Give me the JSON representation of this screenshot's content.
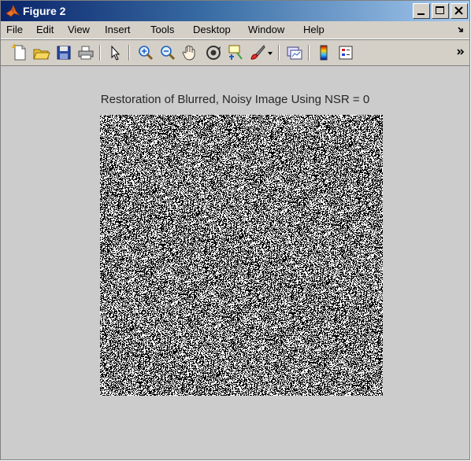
{
  "window": {
    "title": "Figure 2"
  },
  "menubar": {
    "items": [
      "File",
      "Edit",
      "View",
      "Insert",
      "Tools",
      "Desktop",
      "Window",
      "Help"
    ]
  },
  "toolbar": {
    "buttons": [
      "new-figure-icon",
      "open-icon",
      "save-icon",
      "print-icon",
      "pointer-icon",
      "zoom-in-icon",
      "zoom-out-icon",
      "pan-hand-icon",
      "rotate-3d-icon",
      "data-cursor-icon",
      "brush-icon",
      "brush-dropdown-icon",
      "link-plot-icon",
      "colorbar-icon",
      "legend-icon",
      "overflow-icon"
    ]
  },
  "figure": {
    "title": "Restoration of Blurred, Noisy Image Using NSR = 0",
    "background": "#cccccc"
  },
  "colors": {
    "titlebar_start": "#0a246a",
    "titlebar_end": "#a6caf0",
    "chrome": "#d4d0c8"
  }
}
